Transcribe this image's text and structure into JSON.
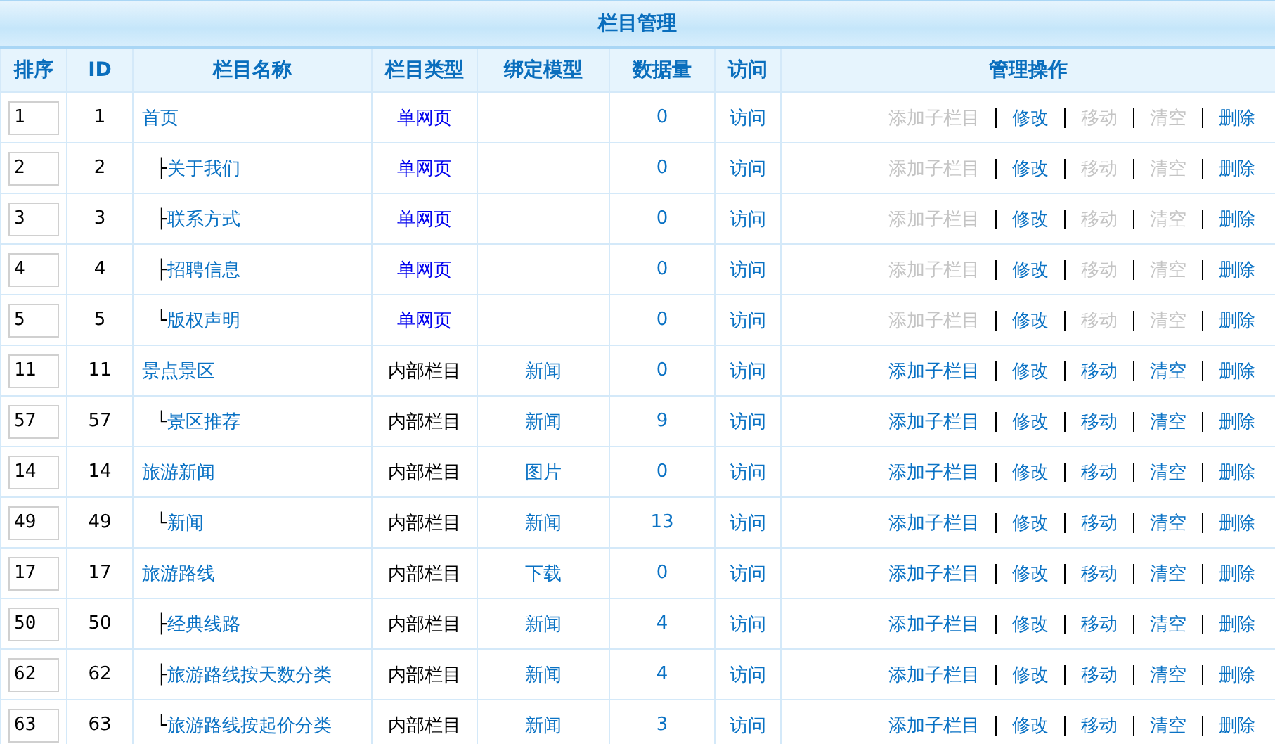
{
  "title": "栏目管理",
  "columns": [
    "排序",
    "ID",
    "栏目名称",
    "栏目类型",
    "绑定模型",
    "数据量",
    "访问",
    "管理操作"
  ],
  "rows": [
    {
      "order": "1",
      "id": "1",
      "name": "首页",
      "kind": "page",
      "type": "单网页",
      "count": "0",
      "visit": "访问",
      "actions": [
        {
          "label": "添加子栏目",
          "disabled": true
        },
        {
          "label": "修改",
          "disabled": false
        },
        {
          "label": "移动",
          "disabled": true
        },
        {
          "label": "清空",
          "disabled": true
        },
        {
          "label": "删除",
          "disabled": false
        }
      ],
      "children": [
        {
          "branch": "├",
          "order": "2",
          "id": "2",
          "name": "关于我们",
          "kind": "page",
          "type": "单网页",
          "count": "0",
          "visit": "访问",
          "actions": [
            {
              "label": "添加子栏目",
              "disabled": true
            },
            {
              "label": "修改",
              "disabled": false
            },
            {
              "label": "移动",
              "disabled": true
            },
            {
              "label": "清空",
              "disabled": true
            },
            {
              "label": "删除",
              "disabled": false
            }
          ]
        },
        {
          "branch": "├",
          "order": "3",
          "id": "3",
          "name": "联系方式",
          "kind": "page",
          "type": "单网页",
          "count": "0",
          "visit": "访问",
          "actions": [
            {
              "label": "添加子栏目",
              "disabled": true
            },
            {
              "label": "修改",
              "disabled": false
            },
            {
              "label": "移动",
              "disabled": true
            },
            {
              "label": "清空",
              "disabled": true
            },
            {
              "label": "删除",
              "disabled": false
            }
          ]
        },
        {
          "branch": "├",
          "order": "4",
          "id": "4",
          "name": "招聘信息",
          "kind": "page",
          "type": "单网页",
          "count": "0",
          "visit": "访问",
          "actions": [
            {
              "label": "添加子栏目",
              "disabled": true
            },
            {
              "label": "修改",
              "disabled": false
            },
            {
              "label": "移动",
              "disabled": true
            },
            {
              "label": "清空",
              "disabled": true
            },
            {
              "label": "删除",
              "disabled": false
            }
          ]
        },
        {
          "branch": "└",
          "order": "5",
          "id": "5",
          "name": "版权声明",
          "kind": "page",
          "type": "单网页",
          "count": "0",
          "visit": "访问",
          "actions": [
            {
              "label": "添加子栏目",
              "disabled": true
            },
            {
              "label": "修改",
              "disabled": false
            },
            {
              "label": "移动",
              "disabled": true
            },
            {
              "label": "清空",
              "disabled": true
            },
            {
              "label": "删除",
              "disabled": false
            }
          ]
        }
      ]
    },
    {
      "order": "11",
      "id": "11",
      "name": "景点景区",
      "kind": "internal",
      "type": "内部栏目",
      "model": "新闻",
      "count": "0",
      "visit": "访问",
      "actions": [
        {
          "label": "添加子栏目",
          "disabled": false
        },
        {
          "label": "修改",
          "disabled": false
        },
        {
          "label": "移动",
          "disabled": false
        },
        {
          "label": "清空",
          "disabled": false
        },
        {
          "label": "删除",
          "disabled": false
        }
      ],
      "children": [
        {
          "branch": "└",
          "order": "57",
          "id": "57",
          "name": "景区推荐",
          "kind": "internal",
          "type": "内部栏目",
          "model": "新闻",
          "count": "9",
          "visit": "访问",
          "actions": [
            {
              "label": "添加子栏目",
              "disabled": false
            },
            {
              "label": "修改",
              "disabled": false
            },
            {
              "label": "移动",
              "disabled": false
            },
            {
              "label": "清空",
              "disabled": false
            },
            {
              "label": "删除",
              "disabled": false
            }
          ]
        }
      ]
    },
    {
      "order": "14",
      "id": "14",
      "name": "旅游新闻",
      "kind": "internal",
      "type": "内部栏目",
      "model": "图片",
      "count": "0",
      "visit": "访问",
      "actions": [
        {
          "label": "添加子栏目",
          "disabled": false
        },
        {
          "label": "修改",
          "disabled": false
        },
        {
          "label": "移动",
          "disabled": false
        },
        {
          "label": "清空",
          "disabled": false
        },
        {
          "label": "删除",
          "disabled": false
        }
      ],
      "children": [
        {
          "branch": "└",
          "order": "49",
          "id": "49",
          "name": "新闻",
          "kind": "internal",
          "type": "内部栏目",
          "model": "新闻",
          "count": "13",
          "visit": "访问",
          "actions": [
            {
              "label": "添加子栏目",
              "disabled": false
            },
            {
              "label": "修改",
              "disabled": false
            },
            {
              "label": "移动",
              "disabled": false
            },
            {
              "label": "清空",
              "disabled": false
            },
            {
              "label": "删除",
              "disabled": false
            }
          ]
        }
      ]
    },
    {
      "order": "17",
      "id": "17",
      "name": "旅游路线",
      "kind": "internal",
      "type": "内部栏目",
      "model": "下载",
      "count": "0",
      "visit": "访问",
      "actions": [
        {
          "label": "添加子栏目",
          "disabled": false
        },
        {
          "label": "修改",
          "disabled": false
        },
        {
          "label": "移动",
          "disabled": false
        },
        {
          "label": "清空",
          "disabled": false
        },
        {
          "label": "删除",
          "disabled": false
        }
      ],
      "children": [
        {
          "branch": "├",
          "order": "50",
          "id": "50",
          "name": "经典线路",
          "kind": "internal",
          "type": "内部栏目",
          "model": "新闻",
          "count": "4",
          "visit": "访问",
          "actions": [
            {
              "label": "添加子栏目",
              "disabled": false
            },
            {
              "label": "修改",
              "disabled": false
            },
            {
              "label": "移动",
              "disabled": false
            },
            {
              "label": "清空",
              "disabled": false
            },
            {
              "label": "删除",
              "disabled": false
            }
          ]
        },
        {
          "branch": "├",
          "order": "62",
          "id": "62",
          "name": "旅游路线按天数分类",
          "kind": "internal",
          "type": "内部栏目",
          "model": "新闻",
          "count": "4",
          "visit": "访问",
          "actions": [
            {
              "label": "添加子栏目",
              "disabled": false
            },
            {
              "label": "修改",
              "disabled": false
            },
            {
              "label": "移动",
              "disabled": false
            },
            {
              "label": "清空",
              "disabled": false
            },
            {
              "label": "删除",
              "disabled": false
            }
          ]
        },
        {
          "branch": "└",
          "order": "63",
          "id": "63",
          "name": "旅游路线按起价分类",
          "kind": "internal",
          "type": "内部栏目",
          "model": "新闻",
          "count": "3",
          "visit": "访问",
          "actions": [
            {
              "label": "添加子栏目",
              "disabled": false
            },
            {
              "label": "修改",
              "disabled": false
            },
            {
              "label": "移动",
              "disabled": false
            },
            {
              "label": "清空",
              "disabled": false
            },
            {
              "label": "删除",
              "disabled": false
            }
          ]
        }
      ]
    }
  ]
}
